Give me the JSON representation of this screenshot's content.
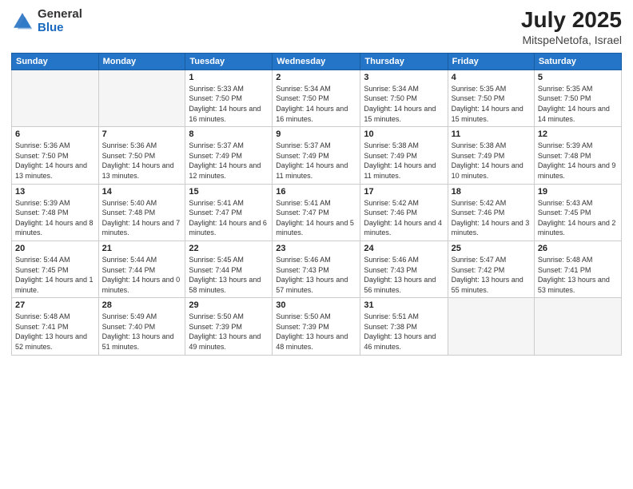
{
  "header": {
    "logo_general": "General",
    "logo_blue": "Blue",
    "month": "July 2025",
    "location": "MitspeNetofa, Israel"
  },
  "weekdays": [
    "Sunday",
    "Monday",
    "Tuesday",
    "Wednesday",
    "Thursday",
    "Friday",
    "Saturday"
  ],
  "weeks": [
    [
      {
        "day": "",
        "sunrise": "",
        "sunset": "",
        "daylight": ""
      },
      {
        "day": "",
        "sunrise": "",
        "sunset": "",
        "daylight": ""
      },
      {
        "day": "1",
        "sunrise": "Sunrise: 5:33 AM",
        "sunset": "Sunset: 7:50 PM",
        "daylight": "Daylight: 14 hours and 16 minutes."
      },
      {
        "day": "2",
        "sunrise": "Sunrise: 5:34 AM",
        "sunset": "Sunset: 7:50 PM",
        "daylight": "Daylight: 14 hours and 16 minutes."
      },
      {
        "day": "3",
        "sunrise": "Sunrise: 5:34 AM",
        "sunset": "Sunset: 7:50 PM",
        "daylight": "Daylight: 14 hours and 15 minutes."
      },
      {
        "day": "4",
        "sunrise": "Sunrise: 5:35 AM",
        "sunset": "Sunset: 7:50 PM",
        "daylight": "Daylight: 14 hours and 15 minutes."
      },
      {
        "day": "5",
        "sunrise": "Sunrise: 5:35 AM",
        "sunset": "Sunset: 7:50 PM",
        "daylight": "Daylight: 14 hours and 14 minutes."
      }
    ],
    [
      {
        "day": "6",
        "sunrise": "Sunrise: 5:36 AM",
        "sunset": "Sunset: 7:50 PM",
        "daylight": "Daylight: 14 hours and 13 minutes."
      },
      {
        "day": "7",
        "sunrise": "Sunrise: 5:36 AM",
        "sunset": "Sunset: 7:50 PM",
        "daylight": "Daylight: 14 hours and 13 minutes."
      },
      {
        "day": "8",
        "sunrise": "Sunrise: 5:37 AM",
        "sunset": "Sunset: 7:49 PM",
        "daylight": "Daylight: 14 hours and 12 minutes."
      },
      {
        "day": "9",
        "sunrise": "Sunrise: 5:37 AM",
        "sunset": "Sunset: 7:49 PM",
        "daylight": "Daylight: 14 hours and 11 minutes."
      },
      {
        "day": "10",
        "sunrise": "Sunrise: 5:38 AM",
        "sunset": "Sunset: 7:49 PM",
        "daylight": "Daylight: 14 hours and 11 minutes."
      },
      {
        "day": "11",
        "sunrise": "Sunrise: 5:38 AM",
        "sunset": "Sunset: 7:49 PM",
        "daylight": "Daylight: 14 hours and 10 minutes."
      },
      {
        "day": "12",
        "sunrise": "Sunrise: 5:39 AM",
        "sunset": "Sunset: 7:48 PM",
        "daylight": "Daylight: 14 hours and 9 minutes."
      }
    ],
    [
      {
        "day": "13",
        "sunrise": "Sunrise: 5:39 AM",
        "sunset": "Sunset: 7:48 PM",
        "daylight": "Daylight: 14 hours and 8 minutes."
      },
      {
        "day": "14",
        "sunrise": "Sunrise: 5:40 AM",
        "sunset": "Sunset: 7:48 PM",
        "daylight": "Daylight: 14 hours and 7 minutes."
      },
      {
        "day": "15",
        "sunrise": "Sunrise: 5:41 AM",
        "sunset": "Sunset: 7:47 PM",
        "daylight": "Daylight: 14 hours and 6 minutes."
      },
      {
        "day": "16",
        "sunrise": "Sunrise: 5:41 AM",
        "sunset": "Sunset: 7:47 PM",
        "daylight": "Daylight: 14 hours and 5 minutes."
      },
      {
        "day": "17",
        "sunrise": "Sunrise: 5:42 AM",
        "sunset": "Sunset: 7:46 PM",
        "daylight": "Daylight: 14 hours and 4 minutes."
      },
      {
        "day": "18",
        "sunrise": "Sunrise: 5:42 AM",
        "sunset": "Sunset: 7:46 PM",
        "daylight": "Daylight: 14 hours and 3 minutes."
      },
      {
        "day": "19",
        "sunrise": "Sunrise: 5:43 AM",
        "sunset": "Sunset: 7:45 PM",
        "daylight": "Daylight: 14 hours and 2 minutes."
      }
    ],
    [
      {
        "day": "20",
        "sunrise": "Sunrise: 5:44 AM",
        "sunset": "Sunset: 7:45 PM",
        "daylight": "Daylight: 14 hours and 1 minute."
      },
      {
        "day": "21",
        "sunrise": "Sunrise: 5:44 AM",
        "sunset": "Sunset: 7:44 PM",
        "daylight": "Daylight: 14 hours and 0 minutes."
      },
      {
        "day": "22",
        "sunrise": "Sunrise: 5:45 AM",
        "sunset": "Sunset: 7:44 PM",
        "daylight": "Daylight: 13 hours and 58 minutes."
      },
      {
        "day": "23",
        "sunrise": "Sunrise: 5:46 AM",
        "sunset": "Sunset: 7:43 PM",
        "daylight": "Daylight: 13 hours and 57 minutes."
      },
      {
        "day": "24",
        "sunrise": "Sunrise: 5:46 AM",
        "sunset": "Sunset: 7:43 PM",
        "daylight": "Daylight: 13 hours and 56 minutes."
      },
      {
        "day": "25",
        "sunrise": "Sunrise: 5:47 AM",
        "sunset": "Sunset: 7:42 PM",
        "daylight": "Daylight: 13 hours and 55 minutes."
      },
      {
        "day": "26",
        "sunrise": "Sunrise: 5:48 AM",
        "sunset": "Sunset: 7:41 PM",
        "daylight": "Daylight: 13 hours and 53 minutes."
      }
    ],
    [
      {
        "day": "27",
        "sunrise": "Sunrise: 5:48 AM",
        "sunset": "Sunset: 7:41 PM",
        "daylight": "Daylight: 13 hours and 52 minutes."
      },
      {
        "day": "28",
        "sunrise": "Sunrise: 5:49 AM",
        "sunset": "Sunset: 7:40 PM",
        "daylight": "Daylight: 13 hours and 51 minutes."
      },
      {
        "day": "29",
        "sunrise": "Sunrise: 5:50 AM",
        "sunset": "Sunset: 7:39 PM",
        "daylight": "Daylight: 13 hours and 49 minutes."
      },
      {
        "day": "30",
        "sunrise": "Sunrise: 5:50 AM",
        "sunset": "Sunset: 7:39 PM",
        "daylight": "Daylight: 13 hours and 48 minutes."
      },
      {
        "day": "31",
        "sunrise": "Sunrise: 5:51 AM",
        "sunset": "Sunset: 7:38 PM",
        "daylight": "Daylight: 13 hours and 46 minutes."
      },
      {
        "day": "",
        "sunrise": "",
        "sunset": "",
        "daylight": ""
      },
      {
        "day": "",
        "sunrise": "",
        "sunset": "",
        "daylight": ""
      }
    ]
  ]
}
